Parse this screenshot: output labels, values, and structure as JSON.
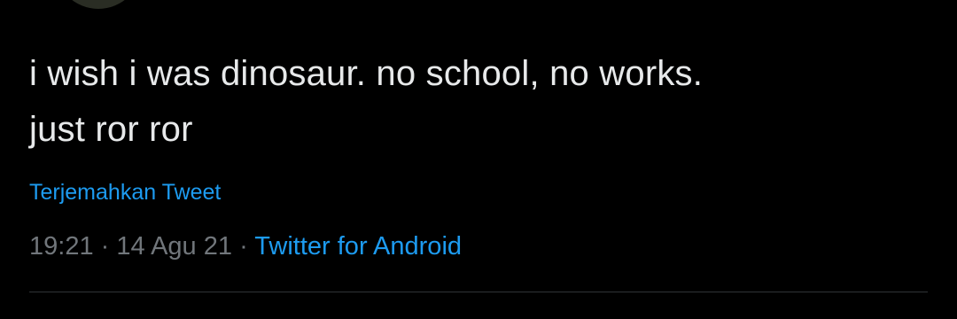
{
  "tweet": {
    "text": "i wish i was dinosaur. no school, no works.\njust ror ror",
    "translate_label": "Terjemahkan Tweet",
    "time": "19:21",
    "separator": "·",
    "date": "14 Agu 21",
    "source": "Twitter for Android"
  },
  "colors": {
    "background": "#000000",
    "text": "#e7e9ea",
    "link": "#1d9bf0",
    "muted": "#71767b",
    "divider": "#2f3336"
  }
}
